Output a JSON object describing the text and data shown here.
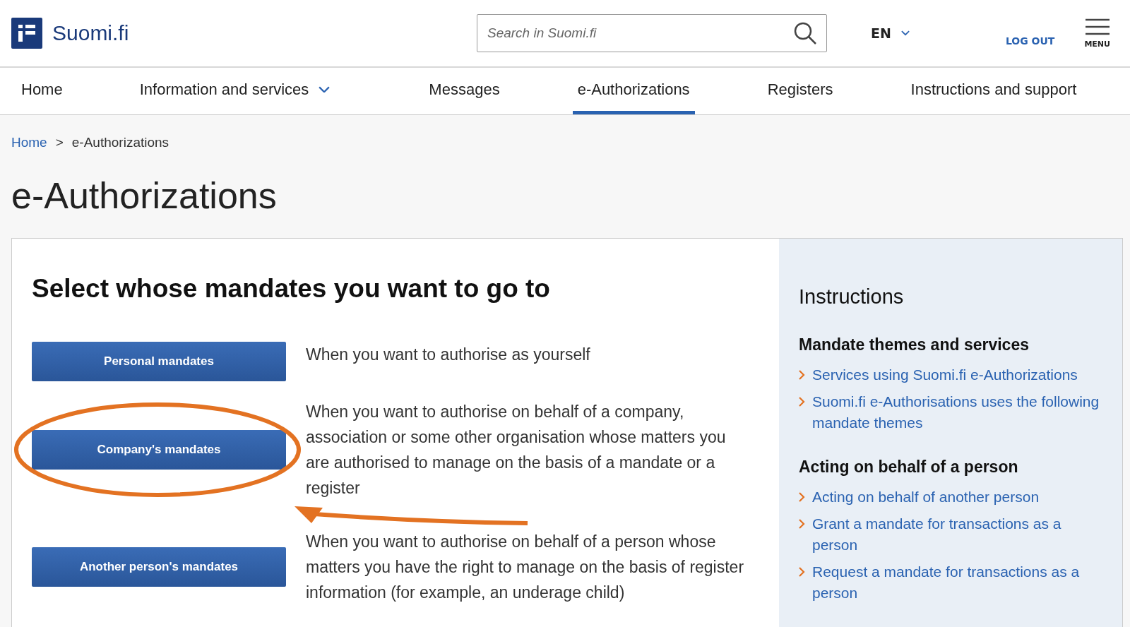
{
  "header": {
    "logo_text": "Suomi.fi",
    "search": {
      "placeholder": "Search in Suomi.fi"
    },
    "language": "EN",
    "logout": "LOG OUT",
    "menu": "MENU"
  },
  "nav": [
    {
      "label": "Home",
      "selected": false,
      "has_dropdown": false
    },
    {
      "label": "Information and services",
      "selected": false,
      "has_dropdown": true
    },
    {
      "label": "Messages",
      "selected": false,
      "has_dropdown": false
    },
    {
      "label": "e-Authorizations",
      "selected": true,
      "has_dropdown": false
    },
    {
      "label": "Registers",
      "selected": false,
      "has_dropdown": false
    },
    {
      "label": "Instructions and support",
      "selected": false,
      "has_dropdown": false
    }
  ],
  "breadcrumb": [
    {
      "label": "Home",
      "link": true
    },
    {
      "label": "e-Authorizations",
      "link": false
    }
  ],
  "breadcrumb_separator": ">",
  "page_title": "e-Authorizations",
  "main": {
    "heading": "Select whose mandates you want to go to",
    "options": [
      {
        "button": "Personal mandates",
        "description": "When you want to authorise as yourself",
        "highlighted": false
      },
      {
        "button": "Company's mandates",
        "description": "When you want to authorise on behalf of a company, association or some other organisation whose matters you are authorised to manage on the basis of a mandate or a register",
        "highlighted": true
      },
      {
        "button": "Another person's mandates",
        "description": "When you want to authorise on behalf of a person whose matters you have the right to manage on the basis of register information (for example, an underage child)",
        "highlighted": false
      }
    ]
  },
  "instructions": {
    "title": "Instructions",
    "sections": [
      {
        "heading": "Mandate themes and services",
        "links": [
          "Services using Suomi.fi e-Authorizations",
          "Suomi.fi e-Authorisations uses the following mandate themes"
        ]
      },
      {
        "heading": "Acting on behalf of a person",
        "links": [
          "Acting on behalf of another person",
          "Grant a mandate for transactions as a person",
          "Request a mandate for transactions as a person"
        ]
      }
    ]
  }
}
